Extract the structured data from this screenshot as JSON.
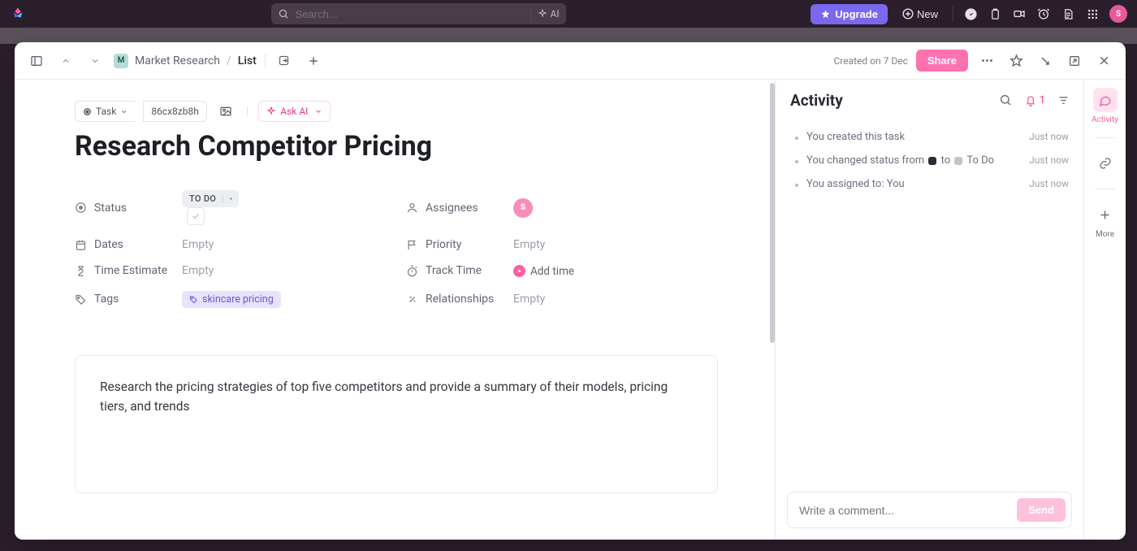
{
  "topbar": {
    "search_placeholder": "Search...",
    "ai_label": "AI",
    "upgrade_label": "Upgrade",
    "new_label": "New",
    "avatar_initial": "S"
  },
  "header": {
    "breadcrumb_workspace_initial": "M",
    "breadcrumb_workspace": "Market Research",
    "breadcrumb_sep": "/",
    "breadcrumb_current": "List",
    "created_text": "Created on 7 Dec",
    "share_label": "Share"
  },
  "task": {
    "type_label": "Task",
    "id": "86cx8zb8h",
    "ask_ai_label": "Ask AI",
    "title": "Research Competitor Pricing",
    "fields": {
      "status": {
        "label": "Status",
        "value": "TO DO"
      },
      "dates": {
        "label": "Dates",
        "value": "Empty"
      },
      "time_estimate": {
        "label": "Time Estimate",
        "value": "Empty"
      },
      "tags": {
        "label": "Tags",
        "value": "skincare pricing"
      },
      "assignees": {
        "label": "Assignees",
        "initial": "S"
      },
      "priority": {
        "label": "Priority",
        "value": "Empty"
      },
      "track_time": {
        "label": "Track Time",
        "value": "Add time"
      },
      "relationships": {
        "label": "Relationships",
        "value": "Empty"
      }
    },
    "description": "Research the pricing strategies of top five competitors and provide a summary of their models, pricing tiers, and trends"
  },
  "activity": {
    "title": "Activity",
    "notification_count": "1",
    "items": [
      {
        "text": "You created this task",
        "time": "Just now"
      },
      {
        "text_pre": "You changed status from ",
        "text_mid": " to ",
        "text_post": " To Do",
        "time": "Just now",
        "has_status": true
      },
      {
        "text": "You assigned to: You",
        "time": "Just now"
      }
    ],
    "comment_placeholder": "Write a comment...",
    "send_label": "Send"
  },
  "rail": {
    "activity_label": "Activity",
    "more_label": "More"
  }
}
